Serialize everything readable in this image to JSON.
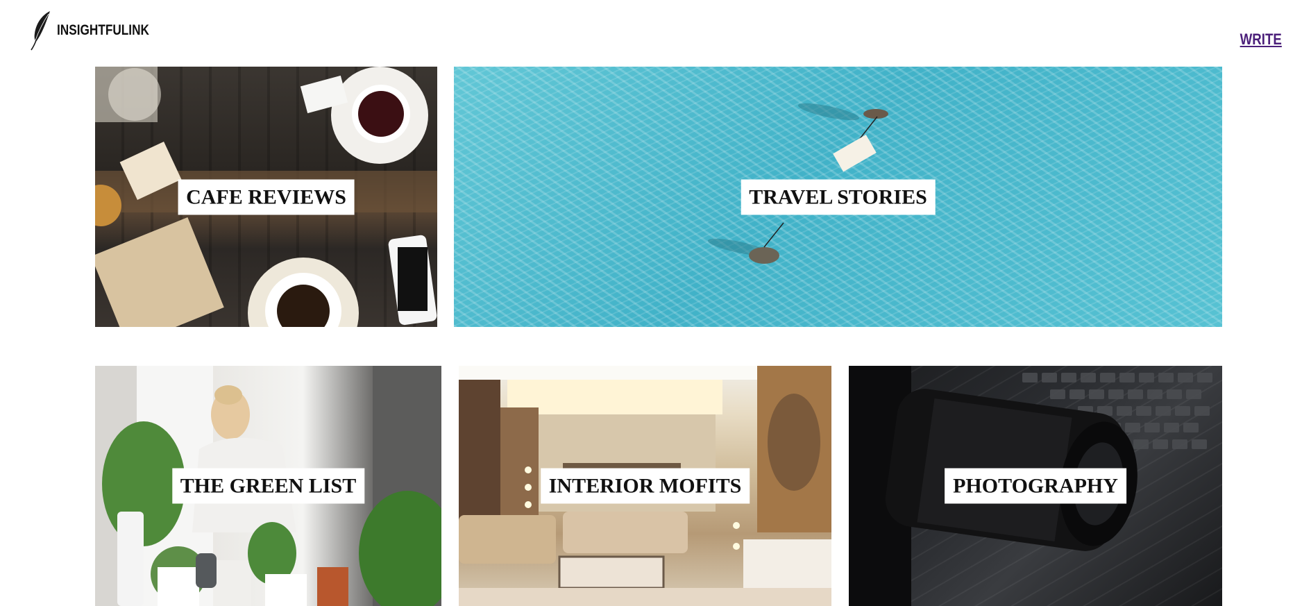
{
  "header": {
    "brand_name": "INSIGHTFULINK",
    "write_label": "WRITE",
    "logo_icon": "feather-quill-icon"
  },
  "categories": [
    {
      "label": "CAFE REVIEWS",
      "image": "cafe-table-coffee-photo"
    },
    {
      "label": "TRAVEL STORIES",
      "image": "turquoise-sea-aerial-photo"
    },
    {
      "label": "THE GREEN LIST",
      "image": "woman-potting-plants-photo"
    },
    {
      "label": "INTERIOR MOFITS",
      "image": "living-room-interior-photo"
    },
    {
      "label": "PHOTOGRAPHY",
      "image": "camera-lens-laptop-photo"
    }
  ],
  "colors": {
    "write_link": "#4b1f7a",
    "label_bg": "#ffffff",
    "label_text": "#111111"
  }
}
